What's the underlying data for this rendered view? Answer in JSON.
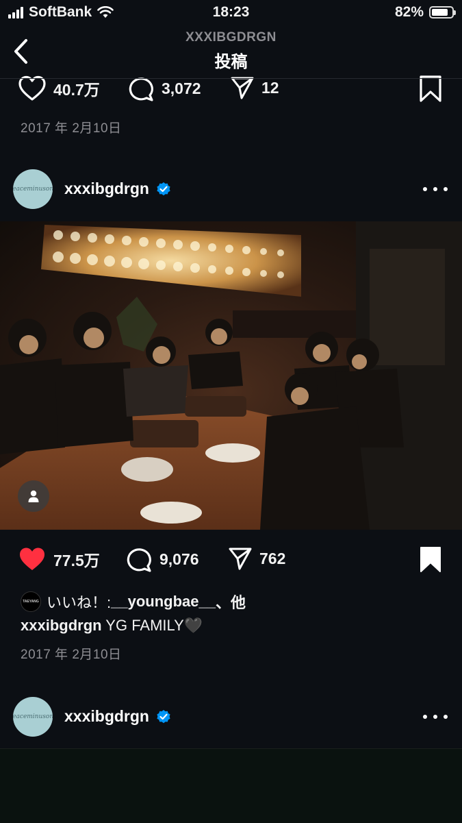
{
  "status_bar": {
    "carrier": "SoftBank",
    "time": "18:23",
    "battery_percent": "82%",
    "battery_level": 0.82
  },
  "header": {
    "username": "XXXIBGDRGN",
    "title": "投稿"
  },
  "prev_post": {
    "likes": "40.7万",
    "comments": "3,072",
    "shares": "12",
    "date": "2017 年 2月10日"
  },
  "post": {
    "username": "xxxibgdrgn",
    "avatar_text": "Peaceminusone",
    "likes": "77.5万",
    "comments": "9,076",
    "shares": "762",
    "liked_by_prefix": "いいね！: ",
    "liked_by_user": "__youngbae__",
    "liked_by_suffix": "、他",
    "liker_avatar_text": "TAEYANG",
    "caption_user": "xxxibgdrgn",
    "caption_text": " YG FAMILY🖤",
    "date": "2017 年 2月10日"
  },
  "next_post": {
    "username": "xxxibgdrgn",
    "avatar_text": "Peaceminusone"
  },
  "colors": {
    "background": "#0c0f14",
    "like_red": "#ff3040",
    "verified_blue": "#0095f6",
    "muted": "#8e8e93"
  }
}
